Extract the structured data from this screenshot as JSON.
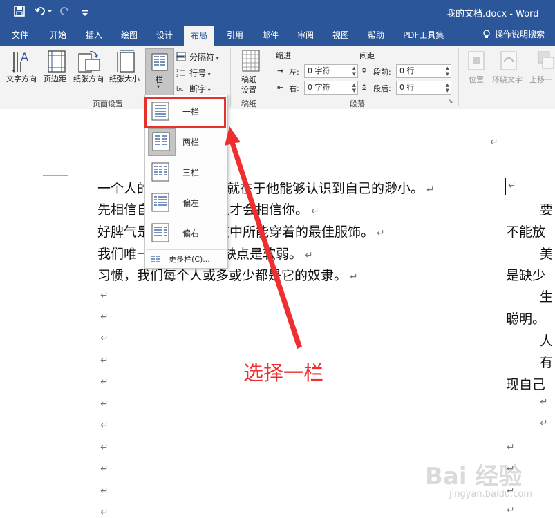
{
  "titlebar": {
    "doc_title": "我的文档.docx - Word"
  },
  "tabs": [
    "文件",
    "开始",
    "插入",
    "绘图",
    "设计",
    "布局",
    "引用",
    "邮件",
    "审阅",
    "视图",
    "帮助",
    "PDF工具集"
  ],
  "tell_me": "操作说明搜索",
  "ribbon": {
    "page_setup": {
      "text_direction": "文字方向",
      "margins": "页边距",
      "orientation": "纸张方向",
      "size": "纸张大小",
      "columns": "栏",
      "breaks": "分隔符",
      "line_numbers": "行号",
      "hyphenation": "断字",
      "group_label": "页面设置"
    },
    "manuscript": {
      "label1": "稿纸",
      "label2": "设置",
      "group_label": "稿纸"
    },
    "paragraph": {
      "indent": "缩进",
      "spacing": "间距",
      "left": "左:",
      "right": "右:",
      "left_value": "0 字符",
      "right_value": "0 字符",
      "before": "段前:",
      "after": "段后:",
      "before_value": "0 行",
      "after_value": "0 行",
      "group_label": "段落"
    },
    "arrange": {
      "position": "位置",
      "wrap": "环绕文字",
      "forward": "上移一"
    }
  },
  "columns_menu": {
    "items": [
      "一栏",
      "两栏",
      "三栏",
      "偏左",
      "偏右"
    ],
    "more": "更多栏(C)..."
  },
  "document": {
    "lines": [
      "一个人的",
      "处就在于他能够认识到自己的渺小。",
      "先相信自",
      "人才会相信你。",
      "好脾气是",
      "交中所能穿着的最佳服饰。",
      "我们唯一",
      "缺点是软弱。",
      "习惯，我们每个人或多或少都是它的奴隶。"
    ],
    "right_column": [
      "要",
      "不能放",
      "美",
      "是缺少",
      "生",
      "聪明。",
      "人",
      "有",
      "现自己"
    ],
    "para_mark": "↵"
  },
  "annotation": "选择一栏",
  "watermark": {
    "main": "Bai 经验",
    "sub": "jingyan.baidu.com"
  },
  "colors": {
    "accent": "#2b579a",
    "annotation_red": "#e8312a"
  }
}
